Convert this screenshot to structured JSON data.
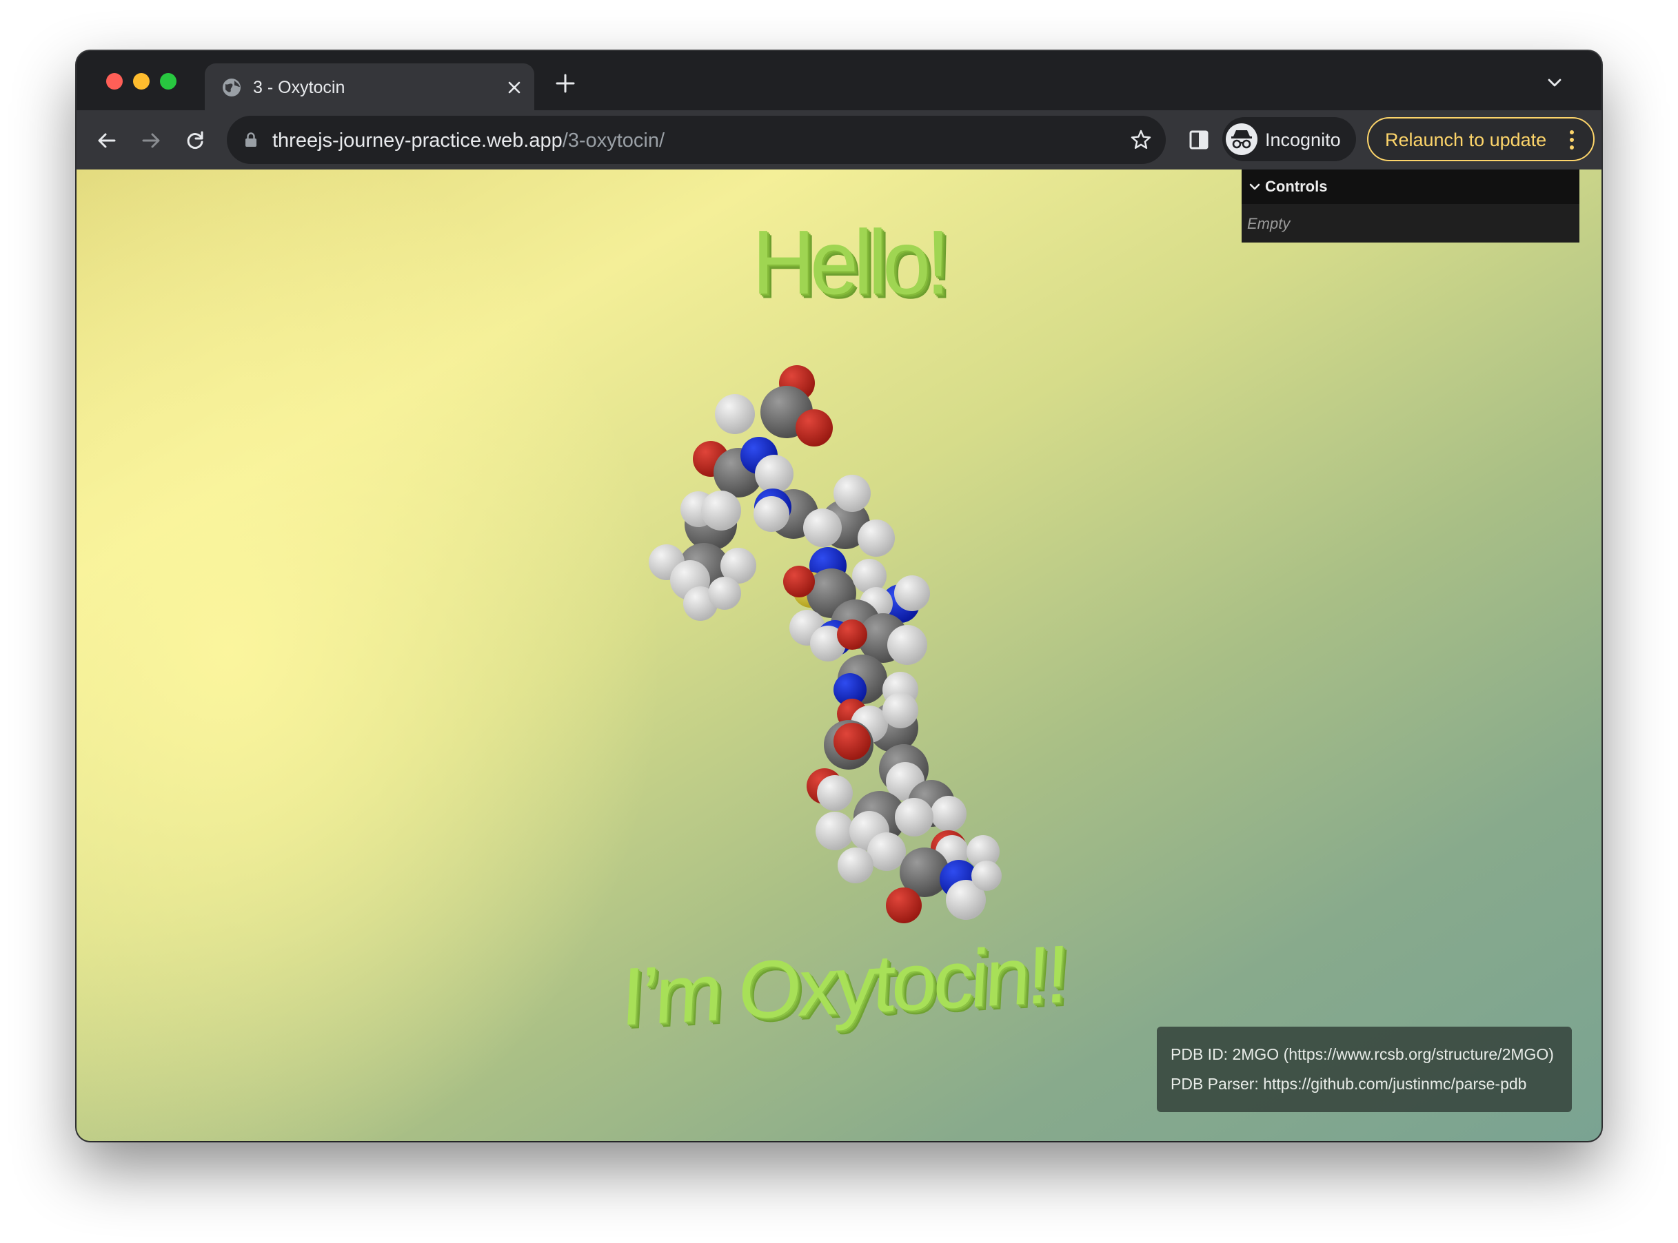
{
  "browser": {
    "tab": {
      "title": "3 - Oxytocin"
    },
    "address": {
      "host": "threejs-journey-practice.web.app",
      "path": "/3-oxytocin/"
    },
    "profile": {
      "label": "Incognito"
    },
    "update_button": {
      "label": "Relaunch to update"
    },
    "colors": {
      "accent_update": "#fcd46a",
      "chrome_dark": "#35363a",
      "tab_bar": "#1f2023"
    }
  },
  "scene": {
    "top_text": "Hello!",
    "bottom_text": "I’m Oxytocin!!",
    "text_color": "#9fd552",
    "atom_colors": {
      "carbon": "#6a6a6a",
      "hydrogen": "#dcdcdc",
      "oxygen": "#c0261c",
      "nitrogen": "#1128c8",
      "sulfur": "#d8c83a"
    }
  },
  "controls_panel": {
    "title": "Controls",
    "empty_text": "Empty"
  },
  "credits": {
    "line1": "PDB ID: 2MGO (https://www.rcsb.org/structure/2MGO)",
    "line2": "PDB Parser: https://github.com/justinmc/parse-pdb"
  },
  "icons": [
    "globe-icon",
    "close-icon",
    "plus-icon",
    "chevron-down-icon",
    "back-arrow-icon",
    "forward-arrow-icon",
    "reload-icon",
    "lock-icon",
    "star-icon",
    "side-panel-icon",
    "incognito-icon",
    "kebab-menu-icon"
  ]
}
